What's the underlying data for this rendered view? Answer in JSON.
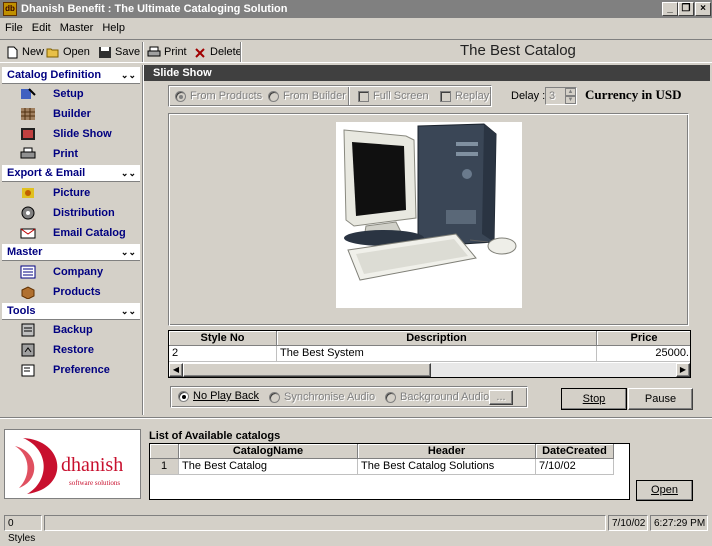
{
  "window": {
    "title": "Dhanish Benefit : The Ultimate Cataloging Solution",
    "app_icon": "db-logo-icon"
  },
  "menu": {
    "file": "File",
    "edit": "Edit",
    "master": "Master",
    "help": "Help"
  },
  "toolbar": {
    "new": "New",
    "open": "Open",
    "save": "Save",
    "print": "Print",
    "delete": "Delete",
    "catalog_title": "The Best Catalog"
  },
  "sidebar": {
    "sections": [
      {
        "title": "Catalog Definition",
        "items": [
          "Setup",
          "Builder",
          "Slide Show",
          "Print"
        ]
      },
      {
        "title": "Export & Email",
        "items": [
          "Picture",
          "Distribution",
          "Email Catalog"
        ]
      },
      {
        "title": "Master",
        "items": [
          "Company",
          "Products"
        ]
      },
      {
        "title": "Tools",
        "items": [
          "Backup",
          "Restore",
          "Preference"
        ]
      }
    ]
  },
  "slideshow": {
    "header": "Slide Show",
    "source_options": {
      "from_products": "From Products",
      "from_builder": "From Builder",
      "full_screen": "Full Screen",
      "replay": "Replay"
    },
    "delay_label": "Delay :",
    "delay_value": "3",
    "currency": "Currency in USD",
    "product_table": {
      "columns": [
        "Style No",
        "Description",
        "Price"
      ],
      "rows": [
        [
          "2",
          "The Best System",
          "25000."
        ]
      ]
    },
    "audio_options": {
      "no_playback": "No Play Back",
      "sync_audio": "Synchronise Audio",
      "background_audio": "Background Audio",
      "browse": "..."
    },
    "stop": "Stop",
    "pause": "Pause"
  },
  "catalogs": {
    "label": "List of Available catalogs",
    "columns": [
      "CatalogName",
      "Header",
      "DateCreated"
    ],
    "rows": [
      [
        "1",
        "The Best Catalog",
        "The Best Catalog Solutions",
        "7/10/02"
      ]
    ],
    "open": "Open"
  },
  "logo": {
    "name": "dhanish",
    "tagline": "software solutions"
  },
  "status": {
    "styles": "0 Styles",
    "date": "7/10/02",
    "time": "6:27:29 PM"
  },
  "colors": {
    "accent": "#000080",
    "header_dark": "#404040",
    "logo_red": "#c8102e"
  }
}
